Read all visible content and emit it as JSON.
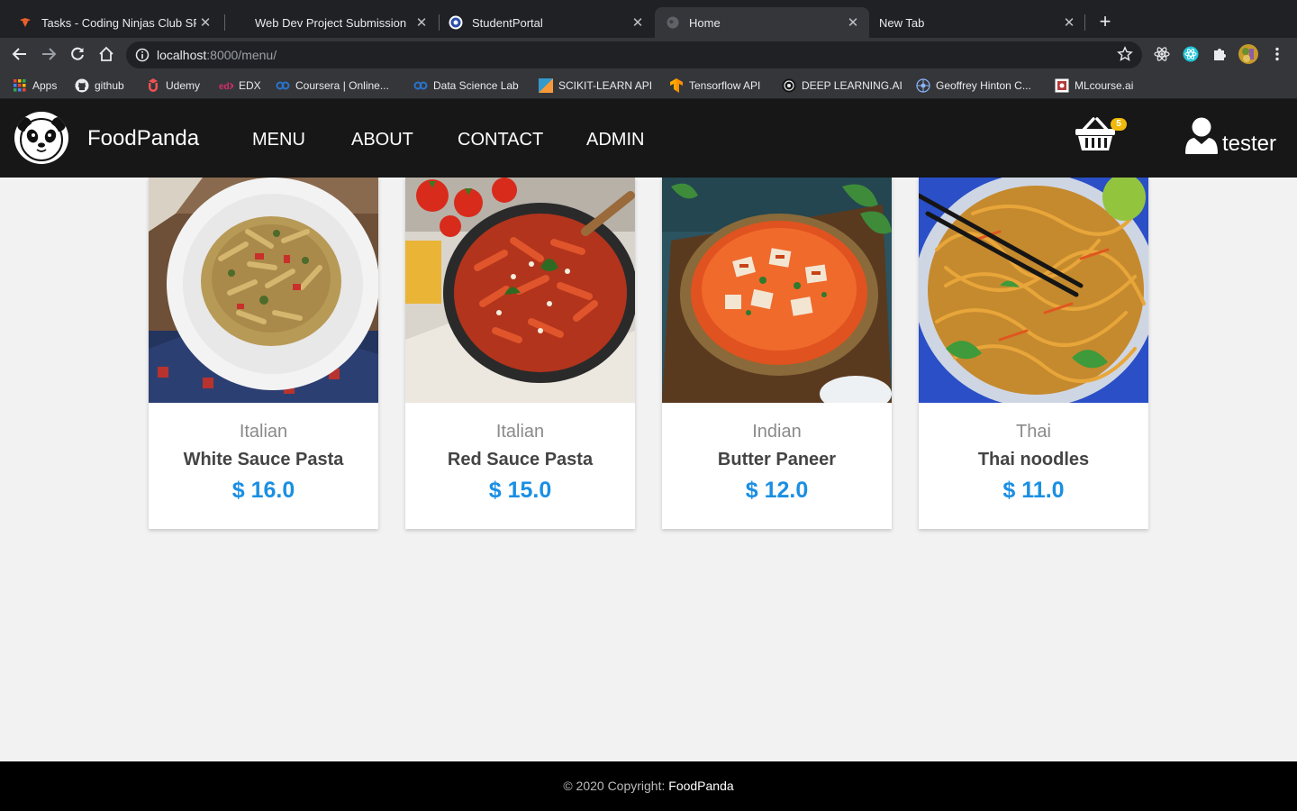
{
  "browser": {
    "tabs": [
      {
        "title": "Tasks - Coding Ninjas Club SRM",
        "active": false
      },
      {
        "title": "Web Dev Project Submission",
        "active": false
      },
      {
        "title": "StudentPortal",
        "active": false
      },
      {
        "title": "Home",
        "active": true
      },
      {
        "title": "New Tab",
        "active": false
      }
    ],
    "new_tab": "+",
    "close_glyph": "✕",
    "url_host": "localhost",
    "url_path": ":8000/menu/",
    "bookmarks": [
      {
        "label": "Apps",
        "icon": "apps-grid-icon"
      },
      {
        "label": "github",
        "icon": "github-icon"
      },
      {
        "label": "Udemy",
        "icon": "udemy-icon"
      },
      {
        "label": "EDX",
        "icon": "edx-icon"
      },
      {
        "label": "Coursera | Online...",
        "icon": "coursera-icon"
      },
      {
        "label": "Data Science Lab",
        "icon": "coursera-icon"
      },
      {
        "label": "SCIKIT-LEARN API",
        "icon": "scikit-icon"
      },
      {
        "label": "Tensorflow API",
        "icon": "tensorflow-icon"
      },
      {
        "label": "DEEP LEARNING.AI",
        "icon": "deeplearning-icon"
      },
      {
        "label": "Geoffrey Hinton C...",
        "icon": "hinton-icon"
      },
      {
        "label": "MLcourse.ai",
        "icon": "mlcourse-icon"
      }
    ]
  },
  "site": {
    "brand": "FoodPanda",
    "nav": [
      "MENU",
      "ABOUT",
      "CONTACT",
      "ADMIN"
    ],
    "cart_count": "5",
    "username": "tester"
  },
  "menu_items": [
    {
      "category": "Italian",
      "name": "White Sauce Pasta",
      "price": "$ 16.0"
    },
    {
      "category": "Italian",
      "name": "Red Sauce Pasta",
      "price": "$ 15.0"
    },
    {
      "category": "Indian",
      "name": "Butter Paneer",
      "price": "$ 12.0"
    },
    {
      "category": "Thai",
      "name": "Thai noodles",
      "price": "$ 11.0"
    }
  ],
  "footer": {
    "prefix": "© 2020 Copyright: ",
    "brand": "FoodPanda"
  },
  "colors": {
    "price": "#1a8fe3",
    "navbar": "#171717",
    "badge": "#f0b90b"
  }
}
